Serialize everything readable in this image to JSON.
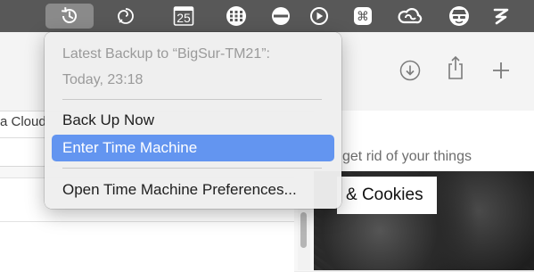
{
  "menubar": {
    "calendar_date": "25",
    "icons": [
      "time-machine-icon",
      "sync-spiral-icon",
      "calendar-icon",
      "keypad-grid-icon",
      "no-entry-icon",
      "play-circle-icon",
      "command-key-icon",
      "creative-cloud-icon",
      "spy-avatar-icon",
      "z-logo-icon"
    ]
  },
  "time_machine_menu": {
    "status_line1": "Latest Backup to “BigSur-TM21”:",
    "status_line2": "Today, 23:18",
    "items": [
      {
        "label": "Back Up Now"
      },
      {
        "label": "Enter Time Machine",
        "highlighted": true
      },
      {
        "label": "Open Time Machine Preferences..."
      }
    ]
  },
  "app": {
    "sidebar_partial_label": "a Cloud",
    "tagline": "get rid of your things",
    "banner_label": "& Cookies"
  },
  "colors": {
    "menubar_bg": "#585858",
    "highlight": "#6395f0"
  }
}
